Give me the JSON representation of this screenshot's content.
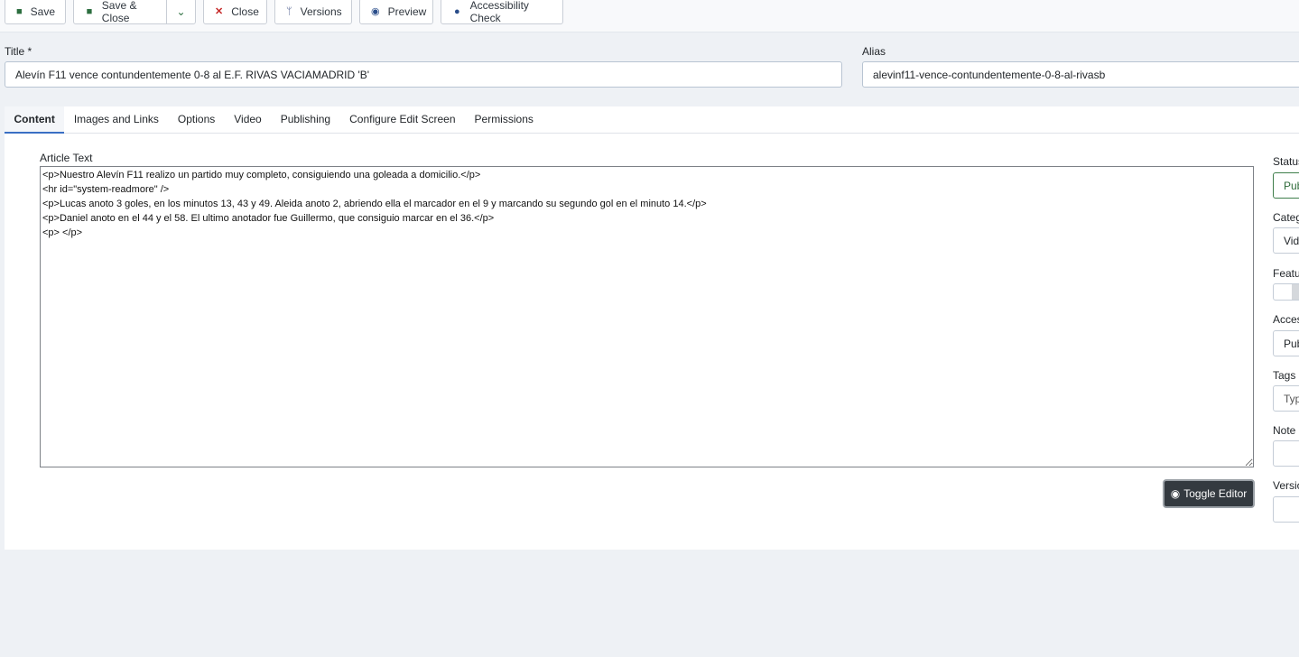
{
  "toolbar": {
    "save": "Save",
    "save_close": "Save & Close",
    "close": "Close",
    "versions": "Versions",
    "preview": "Preview",
    "accessibility": "Accessibility Check"
  },
  "form": {
    "title_label": "Title *",
    "title_value": "Alevín F11 vence contundentemente 0-8 al E.F. RIVAS VACIAMADRID 'B'",
    "alias_label": "Alias",
    "alias_value": "alevinf11-vence-contundentemente-0-8-al-rivasb"
  },
  "tabs": [
    "Content",
    "Images and Links",
    "Options",
    "Video",
    "Publishing",
    "Configure Edit Screen",
    "Permissions"
  ],
  "editor": {
    "label": "Article Text",
    "text": "<p>Nuestro Alevín F11 realizo un partido muy completo, consiguiendo una goleada a domicilio.</p>\n<hr id=\"system-readmore\" />\n<p>Lucas anoto 3 goles, en los minutos 13, 43 y 49. Aleida anoto 2, abriendo ella el marcador en el 9 y marcando su segundo gol en el minuto 14.</p>\n<p>Daniel anoto en el 44 y el 58. El ultimo anotador fue Guillermo, que consiguio marcar en el 36.</p>\n<p> </p>",
    "toggle": "Toggle Editor"
  },
  "sidebar": {
    "status_label": "Status",
    "status_value": "Pub",
    "category_label": "Categ",
    "category_value": "Vid",
    "featured_label": "Featur",
    "access_label": "Acces",
    "access_value": "Pub",
    "tags_label": "Tags",
    "tags_placeholder": "Typ",
    "note_label": "Note",
    "note_value": "",
    "version_label": "Versio",
    "version_value": ""
  }
}
